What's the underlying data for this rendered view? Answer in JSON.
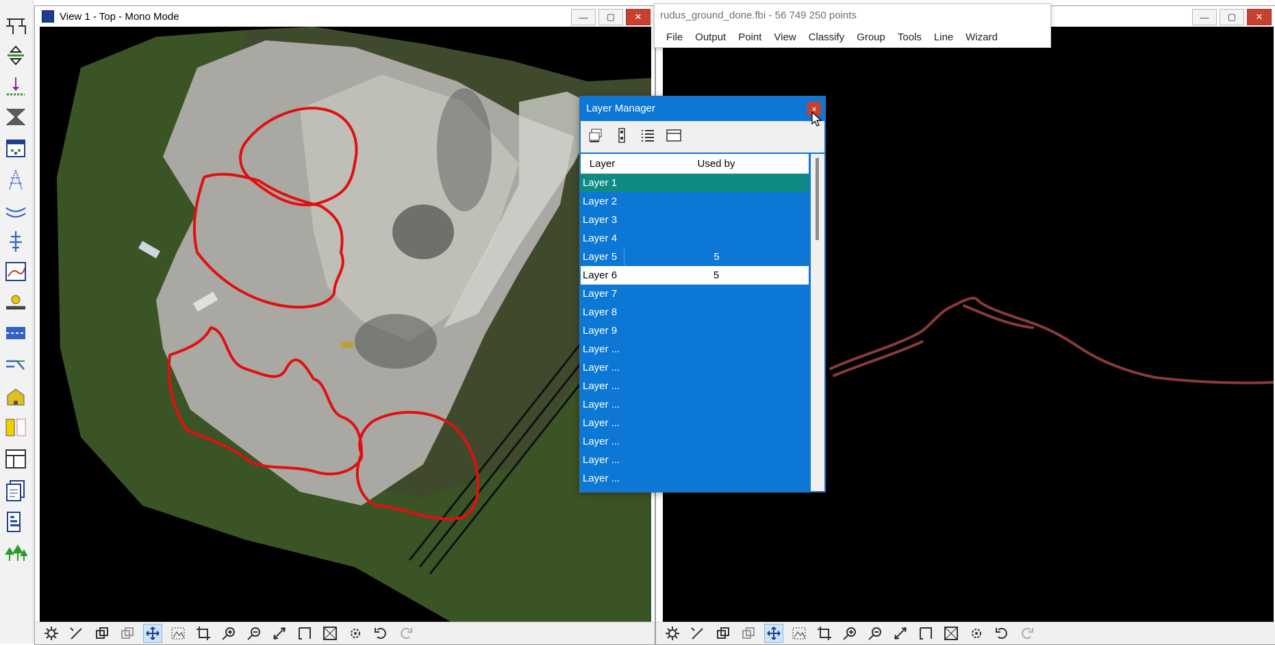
{
  "view1": {
    "title": "View 1 - Top - Mono Mode",
    "controls": [
      "—",
      "▢",
      "✕"
    ]
  },
  "view2": {
    "controls": [
      "—",
      "▢",
      "✕"
    ]
  },
  "app": {
    "title": "rudus_ground_done.fbi - 56 749 250 points",
    "menu": [
      "File",
      "Output",
      "Point",
      "View",
      "Classify",
      "Group",
      "Tools",
      "Line",
      "Wizard"
    ]
  },
  "layer_manager": {
    "title": "Layer Manager",
    "close": "×",
    "columns": {
      "layer": "Layer",
      "used_by": "Used by"
    },
    "rows": [
      {
        "layer": "Layer 1",
        "used_by": ""
      },
      {
        "layer": "Layer 2",
        "used_by": ""
      },
      {
        "layer": "Layer 3",
        "used_by": ""
      },
      {
        "layer": "Layer 4",
        "used_by": ""
      },
      {
        "layer": "Layer 5",
        "used_by": "5"
      },
      {
        "layer": "Layer 6",
        "used_by": "5"
      },
      {
        "layer": "Layer 7",
        "used_by": ""
      },
      {
        "layer": "Layer 8",
        "used_by": ""
      },
      {
        "layer": "Layer 9",
        "used_by": ""
      },
      {
        "layer": "Layer ...",
        "used_by": ""
      },
      {
        "layer": "Layer ...",
        "used_by": ""
      },
      {
        "layer": "Layer ...",
        "used_by": ""
      },
      {
        "layer": "Layer ...",
        "used_by": ""
      },
      {
        "layer": "Layer ...",
        "used_by": ""
      },
      {
        "layer": "Layer ...",
        "used_by": ""
      },
      {
        "layer": "Layer ...",
        "used_by": ""
      },
      {
        "layer": "Layer ...",
        "used_by": ""
      }
    ]
  },
  "colors": {
    "selection_blue": "#0d77d6",
    "active_row_teal": "#0f8a84",
    "boundary_red": "#e01010",
    "profile_points": "#8b3a3a"
  }
}
